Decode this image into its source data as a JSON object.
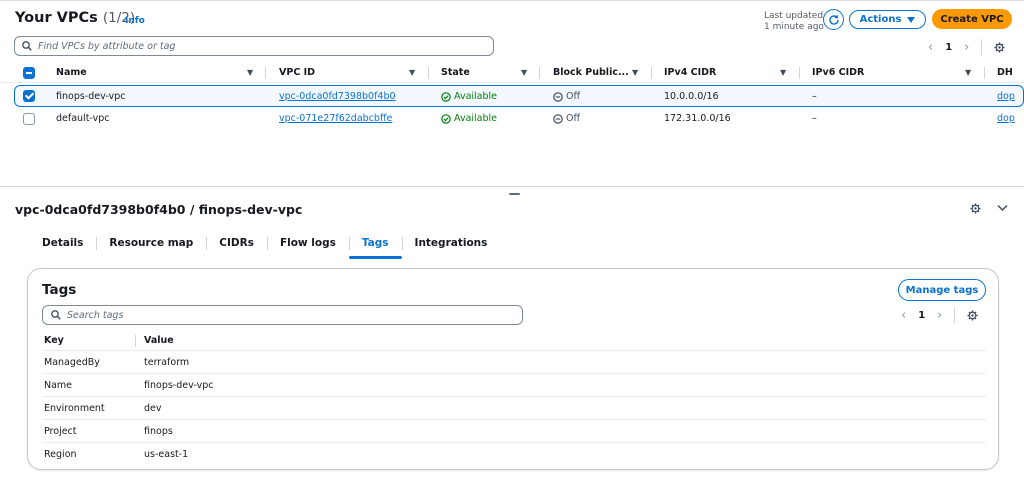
{
  "vpcs": {
    "title": "Your VPCs",
    "count": "(1/2)",
    "info_label": "Info",
    "last_updated_line1": "Last updated",
    "last_updated_line2": "1 minute ago",
    "actions_label": "Actions",
    "create_label": "Create VPC",
    "search_placeholder": "Find VPCs by attribute or tag",
    "page": "1",
    "columns": [
      "Name",
      "VPC ID",
      "State",
      "Block Public...",
      "IPv4 CIDR",
      "IPv6 CIDR",
      "DH"
    ],
    "rows": [
      {
        "name": "finops-dev-vpc",
        "vpc_id": "vpc-0dca0fd7398b0f4b0",
        "state": "Available",
        "block_public": "Off",
        "ipv4_cidr": "10.0.0.0/16",
        "ipv6_cidr": "–",
        "dhcp": "dop",
        "selected": true
      },
      {
        "name": "default-vpc",
        "vpc_id": "vpc-071e27f62dabcbffe",
        "state": "Available",
        "block_public": "Off",
        "ipv4_cidr": "172.31.0.0/16",
        "ipv6_cidr": "–",
        "dhcp": "dop",
        "selected": false
      }
    ]
  },
  "details": {
    "title": "vpc-0dca0fd7398b0f4b0 / finops-dev-vpc",
    "tabs": [
      {
        "label": "Details",
        "active": false
      },
      {
        "label": "Resource map",
        "active": false
      },
      {
        "label": "CIDRs",
        "active": false
      },
      {
        "label": "Flow logs",
        "active": false
      },
      {
        "label": "Tags",
        "active": true
      },
      {
        "label": "Integrations",
        "active": false
      }
    ]
  },
  "tags": {
    "header": "Tags",
    "manage_label": "Manage tags",
    "search_placeholder": "Search tags",
    "page": "1",
    "columns": [
      "Key",
      "Value"
    ],
    "rows": [
      {
        "key": "ManagedBy",
        "value": "terraform"
      },
      {
        "key": "Name",
        "value": "finops-dev-vpc"
      },
      {
        "key": "Environment",
        "value": "dev"
      },
      {
        "key": "Project",
        "value": "finops"
      },
      {
        "key": "Region",
        "value": "us-east-1"
      }
    ]
  },
  "colors": {
    "accent": "#0972d3",
    "primary_button": "#ff9900",
    "success": "#037f0c"
  }
}
